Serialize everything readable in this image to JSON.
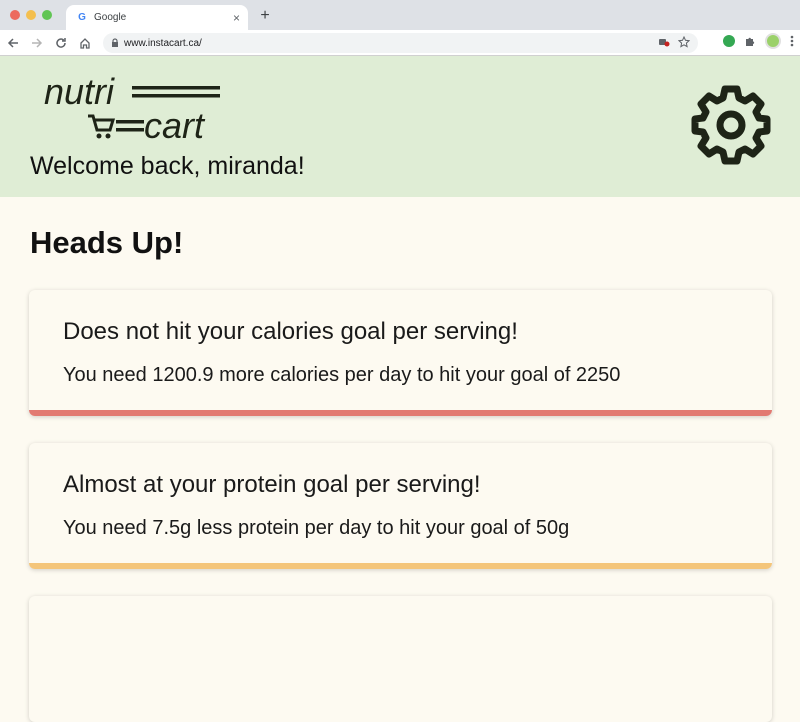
{
  "browser": {
    "tab_title": "Google",
    "tab_favicon": "G",
    "tab_close": "×",
    "new_tab": "+",
    "url": "www.instacart.ca/"
  },
  "icons": {
    "back": "arrow-left-icon",
    "forward": "arrow-right-icon",
    "reload": "reload-icon",
    "home": "home-icon",
    "lock": "lock-icon",
    "camera_blocked": "camera-blocked-icon",
    "star": "star-icon",
    "extension": "puzzle-icon",
    "menu": "kebab-menu-icon",
    "settings": "gear-icon"
  },
  "header": {
    "logo_top": "nutri",
    "logo_bottom": "cart",
    "welcome": "Welcome back, miranda!"
  },
  "main": {
    "title": "Heads Up!",
    "alerts": [
      {
        "title": "Does not hit your calories goal per serving!",
        "body": "You need 1200.9 more calories per day to hit your goal of 2250",
        "bar_color": "#e27a72"
      },
      {
        "title": "Almost at your protein goal per serving!",
        "body": "You need 7.5g less protein per day to hit your goal of 50g",
        "bar_color": "#f4c57a"
      }
    ]
  },
  "colors": {
    "header_bg": "#dfedd5",
    "page_bg": "#fdfaf1",
    "brand_dark": "#1e2417"
  }
}
